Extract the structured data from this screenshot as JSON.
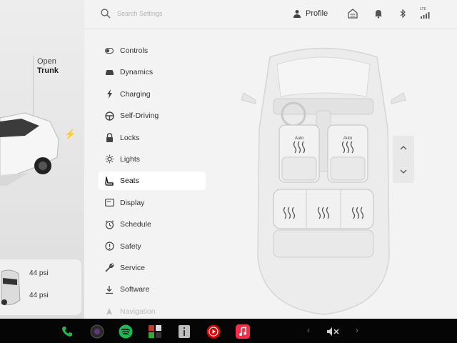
{
  "left_panel": {
    "trunk": {
      "line1": "Open",
      "line2": "Trunk"
    },
    "tires": {
      "front_pressure": "44 psi",
      "rear_pressure": "44 psi"
    }
  },
  "topbar": {
    "search_placeholder": "Search Settings",
    "profile_label": "Profile",
    "network_label": "LTE"
  },
  "menu": {
    "items": [
      {
        "label": "Controls",
        "icon": "toggle-icon"
      },
      {
        "label": "Dynamics",
        "icon": "car-icon"
      },
      {
        "label": "Charging",
        "icon": "bolt-icon"
      },
      {
        "label": "Self-Driving",
        "icon": "steering-wheel-icon"
      },
      {
        "label": "Locks",
        "icon": "lock-icon"
      },
      {
        "label": "Lights",
        "icon": "sun-icon"
      },
      {
        "label": "Seats",
        "icon": "seat-icon",
        "selected": true
      },
      {
        "label": "Display",
        "icon": "display-icon"
      },
      {
        "label": "Schedule",
        "icon": "alarm-icon"
      },
      {
        "label": "Safety",
        "icon": "info-circle-icon"
      },
      {
        "label": "Service",
        "icon": "wrench-icon"
      },
      {
        "label": "Software",
        "icon": "download-icon"
      },
      {
        "label": "Navigation",
        "icon": "navigation-icon"
      }
    ]
  },
  "seats": {
    "front_left_mode": "Auto",
    "front_right_mode": "Auto"
  },
  "colors": {
    "accent_phone": "#2bb24c",
    "spotify": "#1db954",
    "youtube": "#e00000",
    "music": "#fa2d48"
  }
}
